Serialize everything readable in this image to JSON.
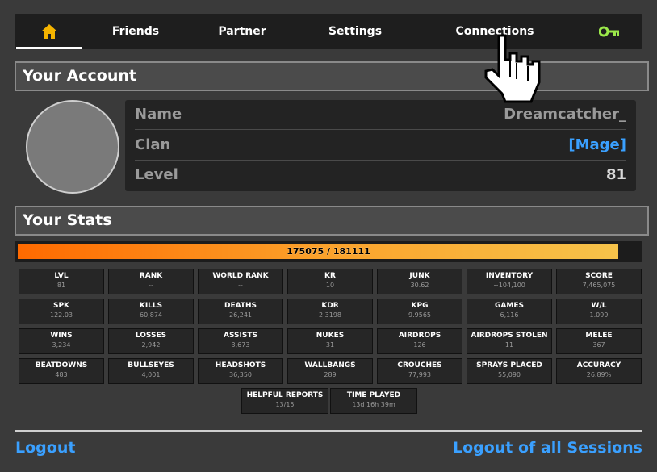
{
  "nav": {
    "items": [
      {
        "name": "tab-home",
        "icon": "home-icon",
        "label": ""
      },
      {
        "name": "tab-friends",
        "label": "Friends"
      },
      {
        "name": "tab-partner",
        "label": "Partner"
      },
      {
        "name": "tab-settings",
        "label": "Settings"
      },
      {
        "name": "tab-connections",
        "label": "Connections"
      },
      {
        "name": "tab-key",
        "icon": "key-icon",
        "label": ""
      }
    ],
    "home_color": "#f5b400",
    "key_color": "#9be84a"
  },
  "account": {
    "title": "Your Account",
    "name_label": "Name",
    "name_value": "Dreamcatcher_",
    "clan_label": "Clan",
    "clan_value": "[Mage]",
    "level_label": "Level",
    "level_value": "81"
  },
  "stats": {
    "title": "Your Stats",
    "xp_text": "175075 / 181111",
    "xp_fraction": 0.9667,
    "items": [
      {
        "label": "LVL",
        "value": "81"
      },
      {
        "label": "RANK",
        "value": "--"
      },
      {
        "label": "WORLD RANK",
        "value": "--"
      },
      {
        "label": "KR",
        "value": "10"
      },
      {
        "label": "JUNK",
        "value": "30.62"
      },
      {
        "label": "INVENTORY",
        "value": "~104,100"
      },
      {
        "label": "SCORE",
        "value": "7,465,075"
      },
      {
        "label": "SPK",
        "value": "122.03"
      },
      {
        "label": "KILLS",
        "value": "60,874"
      },
      {
        "label": "DEATHS",
        "value": "26,241"
      },
      {
        "label": "KDR",
        "value": "2.3198"
      },
      {
        "label": "KPG",
        "value": "9.9565"
      },
      {
        "label": "GAMES",
        "value": "6,116"
      },
      {
        "label": "W/L",
        "value": "1.099"
      },
      {
        "label": "WINS",
        "value": "3,234"
      },
      {
        "label": "LOSSES",
        "value": "2,942"
      },
      {
        "label": "ASSISTS",
        "value": "3,673"
      },
      {
        "label": "NUKES",
        "value": "31"
      },
      {
        "label": "AIRDROPS",
        "value": "126"
      },
      {
        "label": "AIRDROPS STOLEN",
        "value": "11"
      },
      {
        "label": "MELEE",
        "value": "367"
      },
      {
        "label": "BEATDOWNS",
        "value": "483"
      },
      {
        "label": "BULLSEYES",
        "value": "4,001"
      },
      {
        "label": "HEADSHOTS",
        "value": "36,350"
      },
      {
        "label": "WALLBANGS",
        "value": "289"
      },
      {
        "label": "CROUCHES",
        "value": "77,993"
      },
      {
        "label": "SPRAYS PLACED",
        "value": "55,090"
      },
      {
        "label": "ACCURACY",
        "value": "26.89%"
      },
      {
        "label": "HELPFUL REPORTS",
        "value": "13/15"
      },
      {
        "label": "TIME PLAYED",
        "value": "13d 16h 39m"
      }
    ]
  },
  "footer": {
    "logout": "Logout",
    "logout_all": "Logout of all Sessions"
  }
}
